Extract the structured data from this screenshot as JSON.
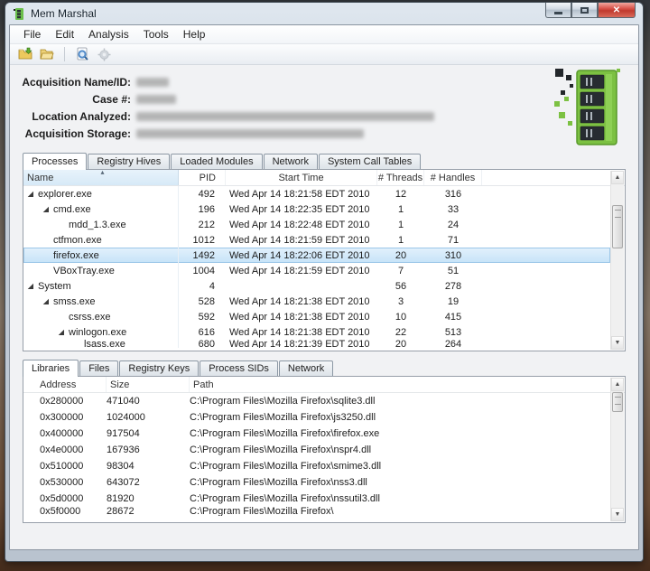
{
  "window": {
    "title": "Mem Marshal",
    "controls": {
      "minimize": "minimize",
      "maximize": "maximize",
      "close": "close"
    }
  },
  "menubar": [
    {
      "label": "File"
    },
    {
      "label": "Edit"
    },
    {
      "label": "Analysis"
    },
    {
      "label": "Tools"
    },
    {
      "label": "Help"
    }
  ],
  "toolbar": {
    "icons": [
      "import-image-icon",
      "open-folder-icon",
      "analyze-icon",
      "settings-icon"
    ]
  },
  "info": {
    "fields": [
      {
        "label": "Acquisition Name/ID:",
        "redacted": true
      },
      {
        "label": "Case #:",
        "redacted": true
      },
      {
        "label": "Location Analyzed:",
        "redacted": true
      },
      {
        "label": "Acquisition Storage:",
        "redacted": true
      }
    ],
    "logo": "ram-memory-stick-logo"
  },
  "process_panel": {
    "tabs": [
      {
        "label": "Processes",
        "active": true
      },
      {
        "label": "Registry Hives"
      },
      {
        "label": "Loaded Modules"
      },
      {
        "label": "Network"
      },
      {
        "label": "System Call Tables"
      }
    ],
    "columns": [
      "Name",
      "PID",
      "Start Time",
      "# Threads",
      "# Handles"
    ],
    "sorted_column": "Name",
    "rows": [
      {
        "name": "explorer.exe",
        "level": 0,
        "expander": true,
        "pid": "492",
        "start": "Wed Apr 14 18:21:58 EDT 2010",
        "threads": "12",
        "handles": "316"
      },
      {
        "name": "cmd.exe",
        "level": 1,
        "expander": true,
        "pid": "196",
        "start": "Wed Apr 14 18:22:35 EDT 2010",
        "threads": "1",
        "handles": "33"
      },
      {
        "name": "mdd_1.3.exe",
        "level": 2,
        "expander": false,
        "pid": "212",
        "start": "Wed Apr 14 18:22:48 EDT 2010",
        "threads": "1",
        "handles": "24"
      },
      {
        "name": "ctfmon.exe",
        "level": 1,
        "expander": false,
        "pid": "1012",
        "start": "Wed Apr 14 18:21:59 EDT 2010",
        "threads": "1",
        "handles": "71"
      },
      {
        "name": "firefox.exe",
        "level": 1,
        "expander": false,
        "pid": "1492",
        "start": "Wed Apr 14 18:22:06 EDT 2010",
        "threads": "20",
        "handles": "310",
        "selected": true
      },
      {
        "name": "VBoxTray.exe",
        "level": 1,
        "expander": false,
        "pid": "1004",
        "start": "Wed Apr 14 18:21:59 EDT 2010",
        "threads": "7",
        "handles": "51"
      },
      {
        "name": "System",
        "level": 0,
        "expander": true,
        "pid": "4",
        "start": "",
        "threads": "56",
        "handles": "278"
      },
      {
        "name": "smss.exe",
        "level": 1,
        "expander": true,
        "pid": "528",
        "start": "Wed Apr 14 18:21:38 EDT 2010",
        "threads": "3",
        "handles": "19"
      },
      {
        "name": "csrss.exe",
        "level": 2,
        "expander": false,
        "pid": "592",
        "start": "Wed Apr 14 18:21:38 EDT 2010",
        "threads": "10",
        "handles": "415"
      },
      {
        "name": "winlogon.exe",
        "level": 2,
        "expander": true,
        "pid": "616",
        "start": "Wed Apr 14 18:21:38 EDT 2010",
        "threads": "22",
        "handles": "513"
      },
      {
        "name": "lsass.exe",
        "level": 3,
        "expander": false,
        "pid": "680",
        "start": "Wed Apr 14 18:21:39 EDT 2010",
        "threads": "20",
        "handles": "264",
        "clipped": true
      }
    ]
  },
  "detail_panel": {
    "tabs": [
      {
        "label": "Libraries",
        "active": true
      },
      {
        "label": "Files"
      },
      {
        "label": "Registry Keys"
      },
      {
        "label": "Process SIDs"
      },
      {
        "label": "Network"
      }
    ],
    "columns": [
      "Address",
      "Size",
      "Path"
    ],
    "rows": [
      {
        "address": "0x280000",
        "size": "471040",
        "path": "C:\\Program Files\\Mozilla Firefox\\sqlite3.dll"
      },
      {
        "address": "0x300000",
        "size": "1024000",
        "path": "C:\\Program Files\\Mozilla Firefox\\js3250.dll"
      },
      {
        "address": "0x400000",
        "size": "917504",
        "path": "C:\\Program Files\\Mozilla Firefox\\firefox.exe"
      },
      {
        "address": "0x4e0000",
        "size": "167936",
        "path": "C:\\Program Files\\Mozilla Firefox\\nspr4.dll"
      },
      {
        "address": "0x510000",
        "size": "98304",
        "path": "C:\\Program Files\\Mozilla Firefox\\smime3.dll"
      },
      {
        "address": "0x530000",
        "size": "643072",
        "path": "C:\\Program Files\\Mozilla Firefox\\nss3.dll"
      },
      {
        "address": "0x5d0000",
        "size": "81920",
        "path": "C:\\Program Files\\Mozilla Firefox\\nssutil3.dll"
      },
      {
        "address": "0x5f0000",
        "size": "28672",
        "path": "C:\\Program Files\\Mozilla Firefox\\",
        "clipped": true
      }
    ]
  },
  "colors": {
    "selection": "#c6e3f8",
    "sorted_header": "#d6e9f7",
    "close_button": "#c03a2e",
    "logo_green": "#7cc142",
    "frame": "#c4cdd8"
  }
}
